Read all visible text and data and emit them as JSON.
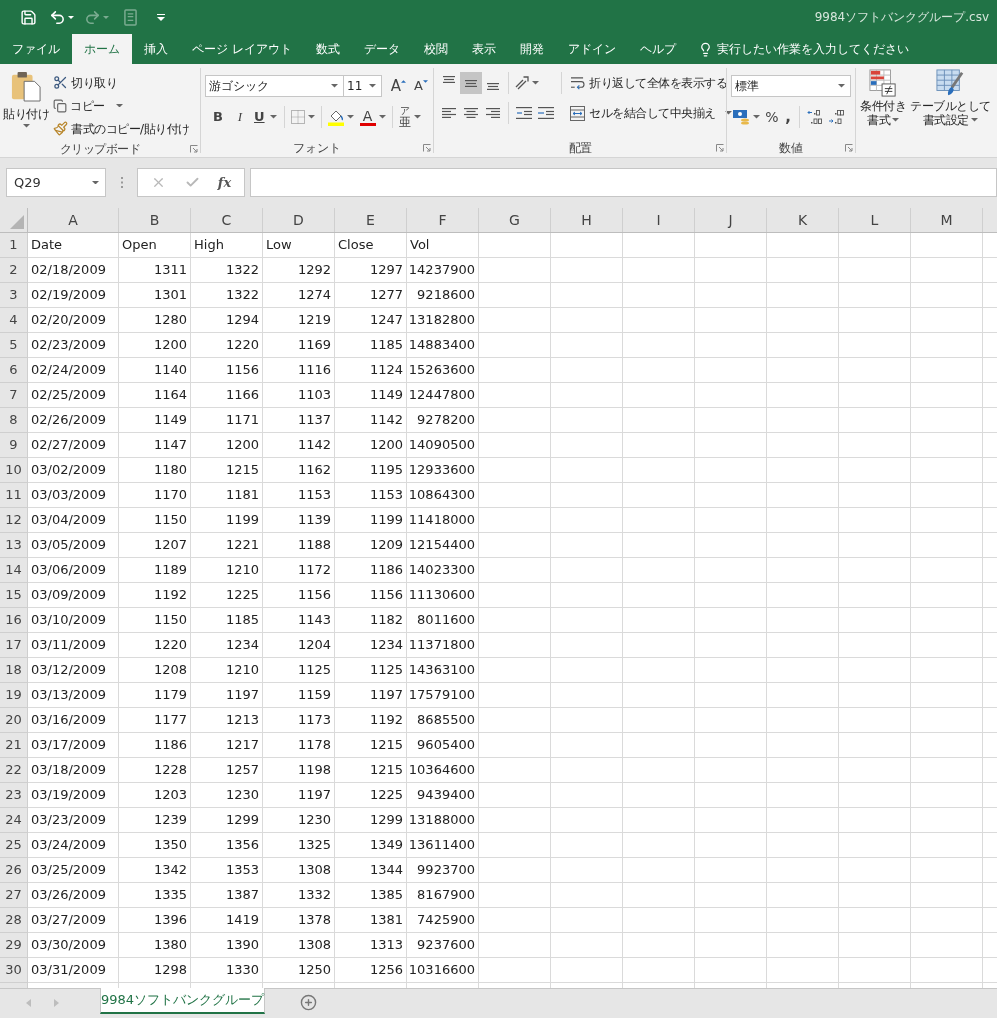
{
  "title_bar": {
    "quick_access": [
      {
        "kind": "save",
        "disabled": false
      },
      {
        "kind": "undo",
        "disabled": false
      },
      {
        "kind": "redo",
        "disabled": true
      },
      {
        "kind": "touch",
        "disabled": true
      }
    ],
    "title": "9984ソフトバンクグループ.csv"
  },
  "tabs": [
    {
      "label": "ファイル",
      "selected": false
    },
    {
      "label": "ホーム",
      "selected": true
    },
    {
      "label": "挿入",
      "selected": false
    },
    {
      "label": "ページ レイアウト",
      "selected": false
    },
    {
      "label": "数式",
      "selected": false
    },
    {
      "label": "データ",
      "selected": false
    },
    {
      "label": "校閲",
      "selected": false
    },
    {
      "label": "表示",
      "selected": false
    },
    {
      "label": "開発",
      "selected": false
    },
    {
      "label": "アドイン",
      "selected": false
    },
    {
      "label": "ヘルプ",
      "selected": false
    }
  ],
  "tell_me": {
    "label": "実行したい作業を入力してください"
  },
  "ribbon": {
    "clipboard": {
      "label": "クリップボード",
      "paste": "貼り付け",
      "cut": "切り取り",
      "copy": "コピー",
      "format_painter": "書式のコピー/貼り付け"
    },
    "font": {
      "label": "フォント",
      "font_name": "游ゴシック",
      "font_size": "11",
      "grow": "A",
      "shrink": "A",
      "bold": "B",
      "italic": "I",
      "underline": "U",
      "font_color": "A",
      "phonetic_ruby": "ア",
      "phonetic_base": "亜"
    },
    "alignment": {
      "label": "配置",
      "vertical": [
        {
          "kind": "top",
          "selected": false
        },
        {
          "kind": "middle",
          "selected": true
        },
        {
          "kind": "bottom",
          "selected": false
        }
      ],
      "horizontal": [
        {
          "kind": "left",
          "selected": false
        },
        {
          "kind": "center",
          "selected": false
        },
        {
          "kind": "right",
          "selected": false
        }
      ],
      "wrap_text": "折り返して全体を表示する",
      "merge_center": "セルを結合して中央揃え"
    },
    "number": {
      "label": "数値",
      "format": "標準",
      "percent": "%",
      "comma": ","
    },
    "styles": {
      "conditional_formatting": [
        "条件付き",
        "書式"
      ],
      "format_as_table": [
        "テーブルとして",
        "書式設定"
      ]
    }
  },
  "formula_bar": {
    "name_box": "Q29",
    "insert_function": "fx"
  },
  "sheet": {
    "columns": [
      "A",
      "B",
      "C",
      "D",
      "E",
      "F",
      "G",
      "H",
      "I",
      "J",
      "K",
      "L",
      "M"
    ],
    "rows": [
      {
        "number": "1",
        "cells": [
          "Date",
          "Open",
          "High",
          "Low",
          "Close",
          "Vol"
        ]
      },
      {
        "number": "2",
        "cells": [
          "02/18/2009",
          "1311",
          "1322",
          "1292",
          "1297",
          "14237900"
        ]
      },
      {
        "number": "3",
        "cells": [
          "02/19/2009",
          "1301",
          "1322",
          "1274",
          "1277",
          "9218600"
        ]
      },
      {
        "number": "4",
        "cells": [
          "02/20/2009",
          "1280",
          "1294",
          "1219",
          "1247",
          "13182800"
        ]
      },
      {
        "number": "5",
        "cells": [
          "02/23/2009",
          "1200",
          "1220",
          "1169",
          "1185",
          "14883400"
        ]
      },
      {
        "number": "6",
        "cells": [
          "02/24/2009",
          "1140",
          "1156",
          "1116",
          "1124",
          "15263600"
        ]
      },
      {
        "number": "7",
        "cells": [
          "02/25/2009",
          "1164",
          "1166",
          "1103",
          "1149",
          "12447800"
        ]
      },
      {
        "number": "8",
        "cells": [
          "02/26/2009",
          "1149",
          "1171",
          "1137",
          "1142",
          "9278200"
        ]
      },
      {
        "number": "9",
        "cells": [
          "02/27/2009",
          "1147",
          "1200",
          "1142",
          "1200",
          "14090500"
        ]
      },
      {
        "number": "10",
        "cells": [
          "03/02/2009",
          "1180",
          "1215",
          "1162",
          "1195",
          "12933600"
        ]
      },
      {
        "number": "11",
        "cells": [
          "03/03/2009",
          "1170",
          "1181",
          "1153",
          "1153",
          "10864300"
        ]
      },
      {
        "number": "12",
        "cells": [
          "03/04/2009",
          "1150",
          "1199",
          "1139",
          "1199",
          "11418000"
        ]
      },
      {
        "number": "13",
        "cells": [
          "03/05/2009",
          "1207",
          "1221",
          "1188",
          "1209",
          "12154400"
        ]
      },
      {
        "number": "14",
        "cells": [
          "03/06/2009",
          "1189",
          "1210",
          "1172",
          "1186",
          "14023300"
        ]
      },
      {
        "number": "15",
        "cells": [
          "03/09/2009",
          "1192",
          "1225",
          "1156",
          "1156",
          "11130600"
        ]
      },
      {
        "number": "16",
        "cells": [
          "03/10/2009",
          "1150",
          "1185",
          "1143",
          "1182",
          "8011600"
        ]
      },
      {
        "number": "17",
        "cells": [
          "03/11/2009",
          "1220",
          "1234",
          "1204",
          "1234",
          "11371800"
        ]
      },
      {
        "number": "18",
        "cells": [
          "03/12/2009",
          "1208",
          "1210",
          "1125",
          "1125",
          "14363100"
        ]
      },
      {
        "number": "19",
        "cells": [
          "03/13/2009",
          "1179",
          "1197",
          "1159",
          "1197",
          "17579100"
        ]
      },
      {
        "number": "20",
        "cells": [
          "03/16/2009",
          "1177",
          "1213",
          "1173",
          "1192",
          "8685500"
        ]
      },
      {
        "number": "21",
        "cells": [
          "03/17/2009",
          "1186",
          "1217",
          "1178",
          "1215",
          "9605400"
        ]
      },
      {
        "number": "22",
        "cells": [
          "03/18/2009",
          "1228",
          "1257",
          "1198",
          "1215",
          "10364600"
        ]
      },
      {
        "number": "23",
        "cells": [
          "03/19/2009",
          "1203",
          "1230",
          "1197",
          "1225",
          "9439400"
        ]
      },
      {
        "number": "24",
        "cells": [
          "03/23/2009",
          "1239",
          "1299",
          "1230",
          "1299",
          "13188000"
        ]
      },
      {
        "number": "25",
        "cells": [
          "03/24/2009",
          "1350",
          "1356",
          "1325",
          "1349",
          "13611400"
        ]
      },
      {
        "number": "26",
        "cells": [
          "03/25/2009",
          "1342",
          "1353",
          "1308",
          "1344",
          "9923700"
        ]
      },
      {
        "number": "27",
        "cells": [
          "03/26/2009",
          "1335",
          "1387",
          "1332",
          "1385",
          "8167900"
        ]
      },
      {
        "number": "28",
        "cells": [
          "03/27/2009",
          "1396",
          "1419",
          "1378",
          "1381",
          "7425900"
        ]
      },
      {
        "number": "29",
        "cells": [
          "03/30/2009",
          "1380",
          "1390",
          "1308",
          "1313",
          "9237600"
        ]
      },
      {
        "number": "30",
        "cells": [
          "03/31/2009",
          "1298",
          "1330",
          "1250",
          "1256",
          "10316600"
        ]
      }
    ]
  },
  "sheet_tabs": [
    {
      "label": "9984ソフトバンクグループ",
      "selected": true
    }
  ]
}
